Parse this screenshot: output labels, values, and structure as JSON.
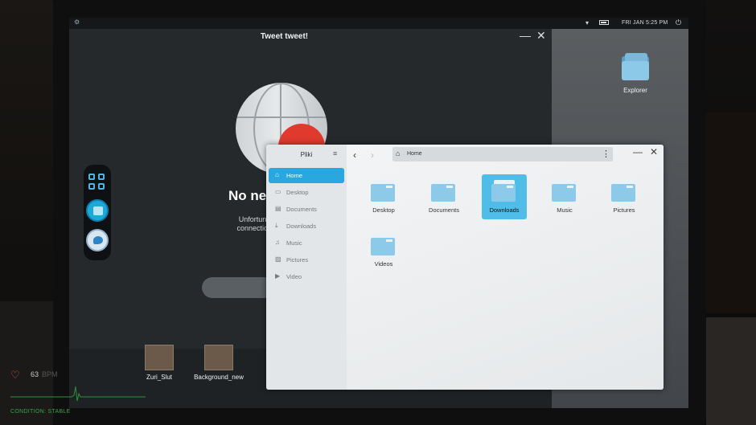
{
  "topbar": {
    "clock": "FRI JAN 5:25 PM",
    "icons": [
      "gear-icon",
      "wifi-icon",
      "battery-icon",
      "power-icon"
    ]
  },
  "tweet_window": {
    "title": "Tweet tweet!",
    "heading": "No net",
    "description_line1": "Unfortunately, there",
    "description_line2": "connection. Please c"
  },
  "dock": {
    "items": [
      "apps-grid-icon",
      "files-icon",
      "tweet-app-icon"
    ]
  },
  "desktop": {
    "explorer_label": "Explorer",
    "files": [
      {
        "label": "Zuri_Slut"
      },
      {
        "label": "Background_new"
      }
    ]
  },
  "pliki": {
    "title": "Pliki",
    "path": "Home",
    "sidebar": [
      {
        "label": "Home",
        "icon": "home-icon",
        "active": true
      },
      {
        "label": "Desktop",
        "icon": "desktop-icon",
        "active": false
      },
      {
        "label": "Documents",
        "icon": "documents-icon",
        "active": false
      },
      {
        "label": "Downloads",
        "icon": "download-icon",
        "active": false
      },
      {
        "label": "Music",
        "icon": "music-icon",
        "active": false
      },
      {
        "label": "Pictures",
        "icon": "pictures-icon",
        "active": false
      },
      {
        "label": "Video",
        "icon": "video-icon",
        "active": false
      }
    ],
    "folders": [
      {
        "label": "Desktop",
        "selected": false
      },
      {
        "label": "Documents",
        "selected": false
      },
      {
        "label": "Downloads",
        "selected": true
      },
      {
        "label": "Music",
        "selected": false
      },
      {
        "label": "Pictures",
        "selected": false
      },
      {
        "label": "Videos",
        "selected": false
      }
    ],
    "accent_color": "#2aa7de"
  },
  "hud": {
    "bpm": "63",
    "bpm_unit": "BPM",
    "condition": "CONDITION: STABLE"
  }
}
